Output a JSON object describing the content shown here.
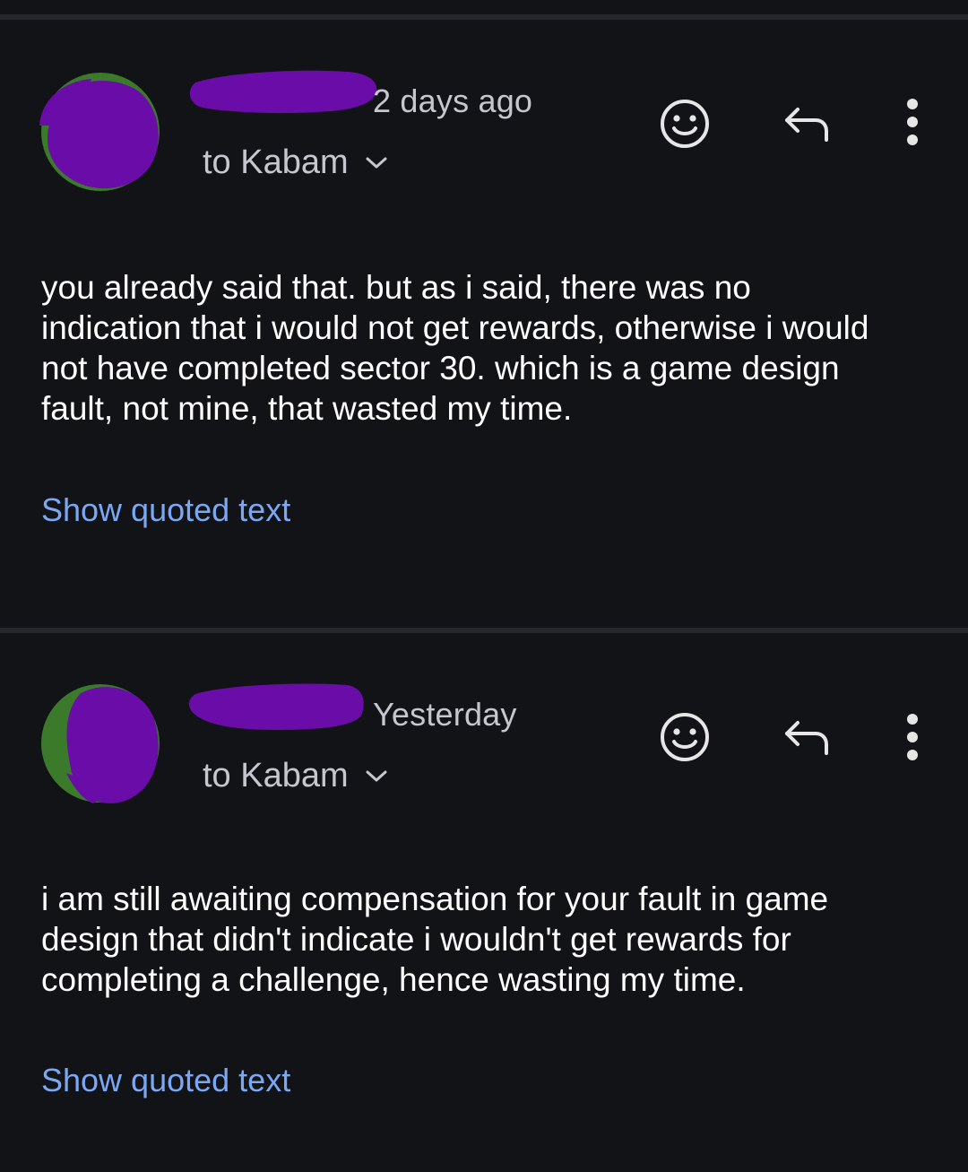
{
  "colors": {
    "background": "#121317",
    "divider": "#26272c",
    "text_primary": "#ffffff",
    "text_secondary": "#c4c7ce",
    "link": "#7aa8f5",
    "redaction_purple": "#6a0ca8",
    "avatar_green": "#3a7a2a"
  },
  "messages": [
    {
      "timestamp": "2 days ago",
      "recipient": "to Kabam",
      "body": "you already said that. but as i said, there was no\nindication that i would not get rewards, otherwise i would\nnot have completed sector 30. which is a game design\nfault, not mine, that wasted my time.",
      "show_quoted": "Show quoted text",
      "icons": [
        "emoji-reaction-icon",
        "reply-icon",
        "more-options-icon"
      ]
    },
    {
      "timestamp": "Yesterday",
      "recipient": "to Kabam",
      "body": "i am still awaiting compensation for your fault in game\ndesign that didn't indicate i wouldn't get rewards for\ncompleting a challenge, hence wasting my time.",
      "show_quoted": "Show quoted text",
      "icons": [
        "emoji-reaction-icon",
        "reply-icon",
        "more-options-icon"
      ]
    }
  ]
}
